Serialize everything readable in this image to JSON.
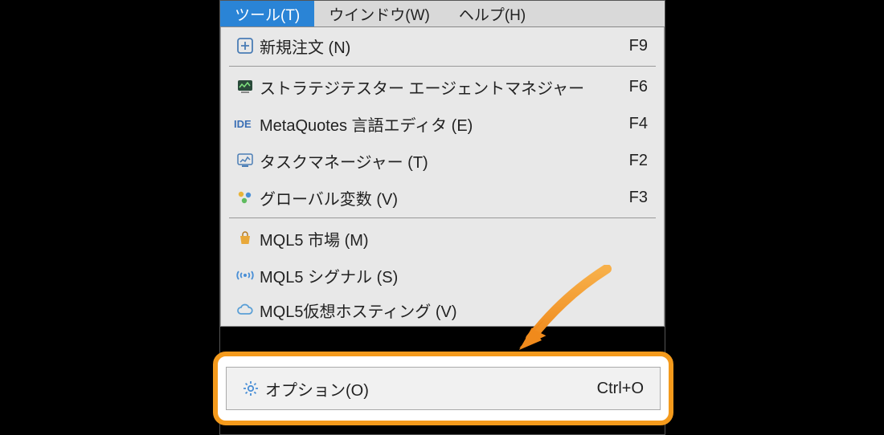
{
  "menubar": {
    "items": [
      {
        "label": "ツール(T)",
        "active": true
      },
      {
        "label": "ウインドウ(W)",
        "active": false
      },
      {
        "label": "ヘルプ(H)",
        "active": false
      }
    ]
  },
  "dropdown": {
    "groups": [
      [
        {
          "icon": "new-order",
          "label": "新規注文 (N)",
          "shortcut": "F9"
        }
      ],
      [
        {
          "icon": "strategy-tester",
          "label": "ストラテジテスター エージェントマネジャー",
          "shortcut": "F6"
        },
        {
          "icon": "ide",
          "label": "MetaQuotes 言語エディタ (E)",
          "shortcut": "F4"
        },
        {
          "icon": "task-manager",
          "label": "タスクマネージャー (T)",
          "shortcut": "F2"
        },
        {
          "icon": "globals",
          "label": "グローバル変数 (V)",
          "shortcut": "F3"
        }
      ],
      [
        {
          "icon": "market",
          "label": "MQL5 市場 (M)",
          "shortcut": ""
        },
        {
          "icon": "signals",
          "label": "MQL5 シグナル (S)",
          "shortcut": ""
        },
        {
          "icon": "cloud",
          "label": "MQL5仮想ホスティング (V)",
          "shortcut": ""
        }
      ]
    ],
    "highlighted": {
      "icon": "options",
      "label": "オプション(O)",
      "shortcut": "Ctrl+O"
    }
  }
}
